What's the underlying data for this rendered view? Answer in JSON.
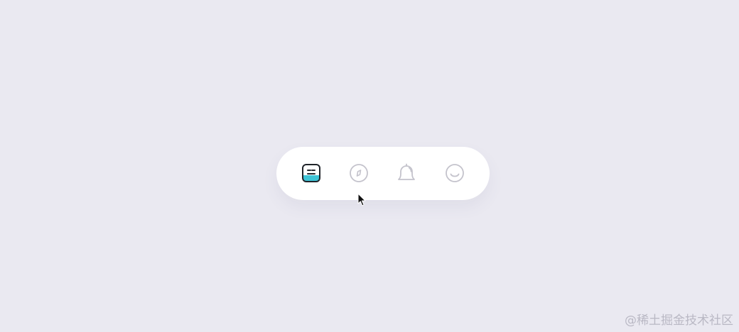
{
  "colors": {
    "background": "#eae9f1",
    "bar": "#ffffff",
    "active_accent": "#3ec4d6",
    "active_stroke": "#20242a",
    "inactive_stroke": "#c4c3cc"
  },
  "tabbar": {
    "tabs": [
      {
        "icon": "notes-face-icon",
        "active": true
      },
      {
        "icon": "compass-icon",
        "active": false
      },
      {
        "icon": "bell-icon",
        "active": false
      },
      {
        "icon": "smile-icon",
        "active": false
      }
    ]
  },
  "watermark": {
    "text": "@稀土掘金技术社区"
  }
}
